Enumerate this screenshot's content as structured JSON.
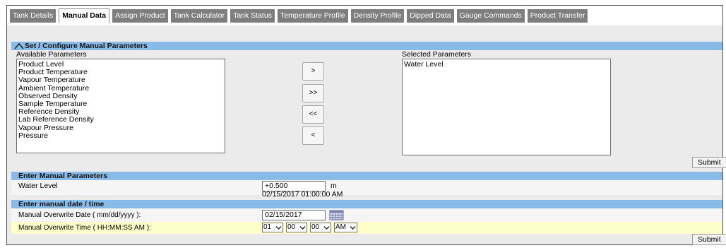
{
  "tabs": [
    {
      "label": "Tank Details"
    },
    {
      "label": "Manual Data",
      "active": true
    },
    {
      "label": "Assign Product"
    },
    {
      "label": "Tank Calculator"
    },
    {
      "label": "Tank Status"
    },
    {
      "label": "Temperature Profile"
    },
    {
      "label": "Density Profile"
    },
    {
      "label": "Dipped Data"
    },
    {
      "label": "Gauge Commands"
    },
    {
      "label": "Product Transfer"
    }
  ],
  "configure": {
    "title": "Set / Configure Manual Parameters",
    "available_label": "Available Parameters",
    "selected_label": "Selected Parameters",
    "available": [
      "Product Level",
      "Product Temperature",
      "Vapour Temperature",
      "Ambient Temperature",
      "Observed Density",
      "Sample Temperature",
      "Reference Density",
      "Lab Reference Density",
      "Vapour Pressure",
      "Pressure"
    ],
    "selected": [
      "Water Level"
    ],
    "buttons": {
      "add": ">",
      "add_all": ">>",
      "remove_all": "<<",
      "remove": "<"
    },
    "submit_label": "Submit"
  },
  "manual_params": {
    "title": "Enter Manual Parameters",
    "param_label": "Water Level",
    "value": "+0.500",
    "unit": "m",
    "timestamp": "02/15/2017 01:00:00 AM"
  },
  "datetime": {
    "title": "Enter manual date / time",
    "date_label": "Manual Overwrite Date ( mm/dd/yyyy ):",
    "date_value": "02/15/2017",
    "time_label": "Manual Overwrite Time ( HH:MM:SS AM ):",
    "hour": "01",
    "minute": "00",
    "second": "00",
    "ampm": "AM",
    "submit_label": "Submit"
  },
  "colors": {
    "section_header": "#88bbe8",
    "time_row_bg": "#ffffcc",
    "tab_bg": "#7e7e7e"
  }
}
